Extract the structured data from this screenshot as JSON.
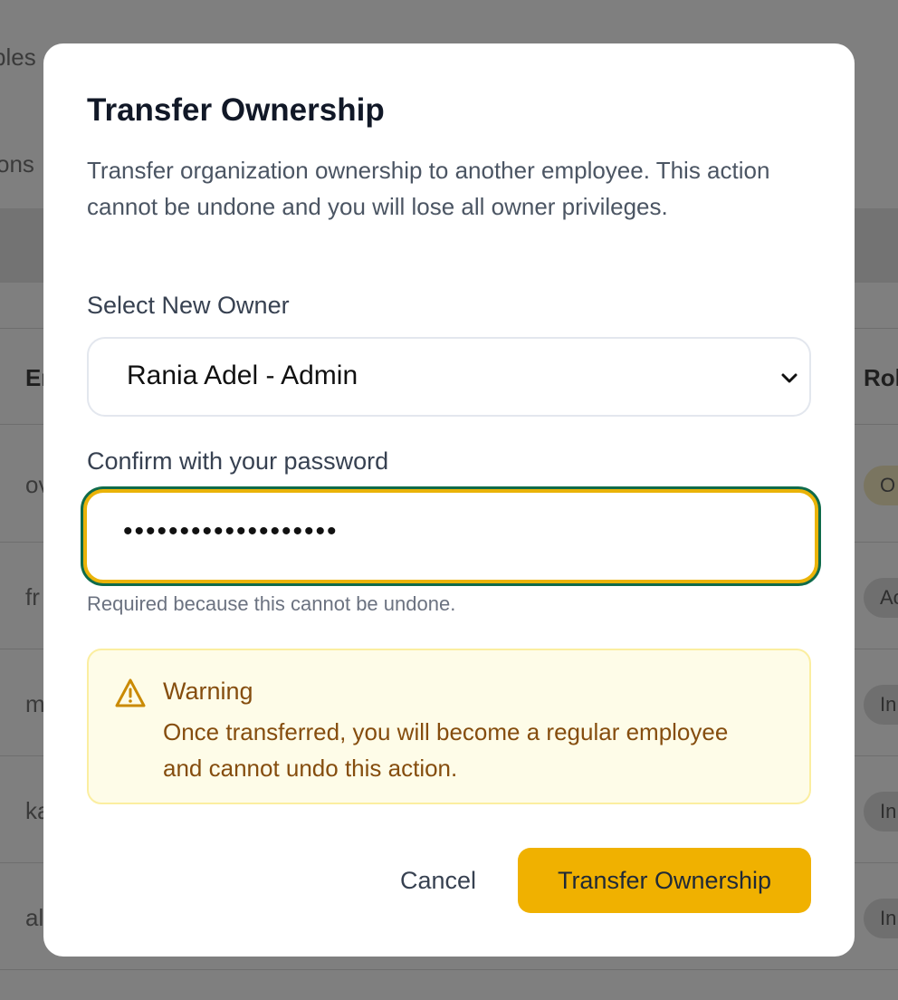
{
  "background": {
    "fragments": [
      "bles",
      "ons",
      "Er",
      "Rol",
      "ov",
      "fr",
      "m",
      "ka",
      "al"
    ],
    "badges": [
      "O",
      "Ac",
      "In",
      "In",
      "In"
    ]
  },
  "modal": {
    "title": "Transfer Ownership",
    "description": "Transfer organization ownership to another employee. This action cannot be undone and you will lose all owner privileges.",
    "owner_label": "Select New Owner",
    "owner_selected": "Rania Adel - Admin",
    "password_label": "Confirm with your password",
    "password_value": "•••••••••••••••••••",
    "password_hint": "Required because this cannot be undone.",
    "warning": {
      "icon": "warning-triangle-icon",
      "title": "Warning",
      "body": "Once transferred, you will become a regular employee and cannot undo this action."
    },
    "cancel_label": "Cancel",
    "transfer_label": "Transfer Ownership"
  },
  "colors": {
    "accent": "#f0b100",
    "focus_ring": "#0f6b4b",
    "warning_bg": "#fefce8",
    "warning_text": "#854d0e"
  }
}
